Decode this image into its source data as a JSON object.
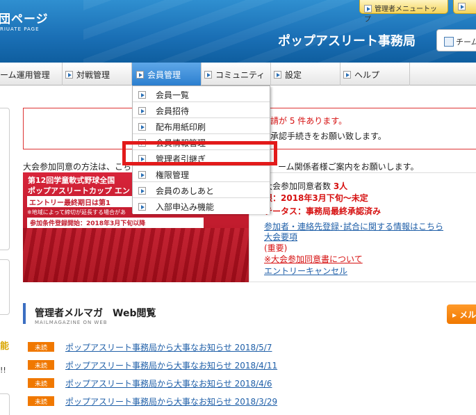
{
  "header": {
    "logo_title": "団ページ",
    "logo_sub": "RIUATE PAGE",
    "top_button": "管理者メニュートップ",
    "office_name": "ポップアスリート事務局",
    "team_box": "チーム"
  },
  "nav": {
    "items": [
      {
        "label": "ーム運用管理"
      },
      {
        "label": "対戦管理"
      },
      {
        "label": "会員管理"
      },
      {
        "label": "コミュニティ"
      },
      {
        "label": "設定"
      },
      {
        "label": "ヘルプ"
      }
    ],
    "active_color": "#2c7fcf"
  },
  "dropdown": {
    "items": [
      {
        "label": "会員一覧"
      },
      {
        "label": "会員招待"
      },
      {
        "label": "配布用紙印刷"
      },
      {
        "label": "会員情報管理"
      },
      {
        "label": "管理者引継ぎ"
      },
      {
        "label": "権限管理"
      },
      {
        "label": "会員のあしあと"
      },
      {
        "label": "入部申込み機能"
      }
    ],
    "highlighted": "管理者引継ぎ",
    "highlight_color": "#e21a1a"
  },
  "notice": {
    "count_text": "請が 5 件あります。",
    "request_text": "承認手続きをお願い致します。"
  },
  "consent": {
    "text_a": "大会参加同意の方法は、こち",
    "text_b": "ーム関係者様ご案内をお願いします。"
  },
  "banner": {
    "line1": "第12回学童軟式野球全国",
    "line2": "ポップアスリートカップ エン",
    "line3": "エントリー最終期日は第1",
    "line4": "※地域によって締切が延長する場合があ",
    "line5": "参加条件登録開始：2018年3月下旬以降"
  },
  "entry": {
    "consent_count_label": "大会参加同意者数 ",
    "consent_count_value": "3人",
    "deadline": "限：2018年3月下旬～未定",
    "status": "テータス：事務局最終承認済み",
    "link_info": "参加者・連絡先登録･試合に関する情報はこちら",
    "link_rules": "大会要項",
    "important": "(重要)",
    "link_consent_doc": "※大会参加同意書について",
    "link_cancel": "エントリーキャンセル"
  },
  "mailmag": {
    "title": "管理者メルマガ　Web閲覧",
    "subtitle": "MAILMAGAZINE ON WEB",
    "button": "▸ メル"
  },
  "news": [
    {
      "badge": "未読",
      "title": "ポップアスリート事務局から大事なお知らせ 2018/5/7"
    },
    {
      "badge": "未読",
      "title": "ポップアスリート事務局から大事なお知らせ 2018/4/11"
    },
    {
      "badge": "未読",
      "title": "ポップアスリート事務局から大事なお知らせ 2018/4/6"
    },
    {
      "badge": "未読",
      "title": "ポップアスリート事務局から大事なお知らせ 2018/3/29"
    }
  ],
  "left": {
    "yellow_text": "能",
    "excl_text": "!!"
  }
}
